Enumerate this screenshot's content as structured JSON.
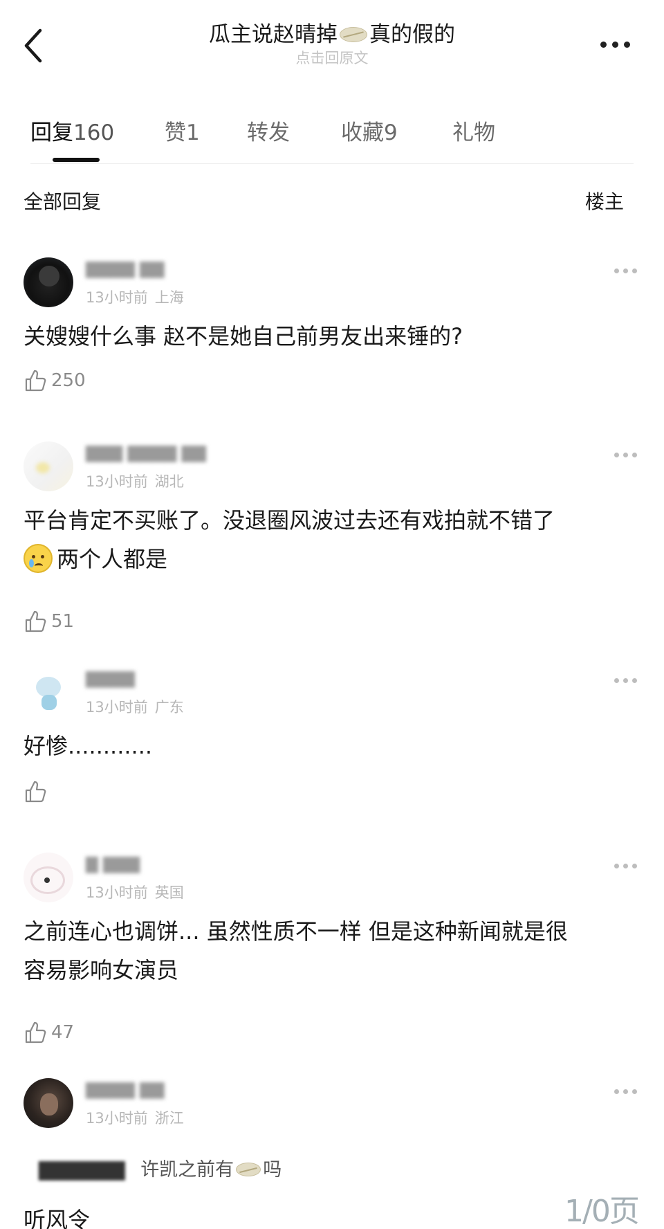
{
  "header": {
    "title_before": "瓜主说赵晴掉",
    "title_after": "真的假的",
    "subtitle": "点击回原文"
  },
  "tabs": [
    {
      "label": "回复",
      "count": "160",
      "active": true
    },
    {
      "label": "赞",
      "count": "1",
      "active": false
    },
    {
      "label": "转发",
      "count": "",
      "active": false
    },
    {
      "label": "收藏",
      "count": "9",
      "active": false
    },
    {
      "label": "礼物",
      "count": "",
      "active": false
    }
  ],
  "filter": {
    "all_label": "全部回复",
    "op_label": "楼主"
  },
  "comments": [
    {
      "time": "13小时前",
      "location": "上海",
      "text": "关嫂嫂什么事 赵不是她自己前男友出来锤的?",
      "likes": "250"
    },
    {
      "time": "13小时前",
      "location": "湖北",
      "text_line1": "平台肯定不买账了。没退圈风波过去还有戏拍就不错了",
      "text_line2": "两个人都是",
      "likes": "51"
    },
    {
      "time": "13小时前",
      "location": "广东",
      "text": "好惨............",
      "likes": ""
    },
    {
      "time": "13小时前",
      "location": "英国",
      "text_line1": "之前连心也调饼... 虽然性质不一样 但是这种新闻就是很",
      "text_line2": "容易影响女演员",
      "likes": "47"
    },
    {
      "time": "13小时前",
      "location": "浙江",
      "quote_text_before": "许凯之前有",
      "quote_text_after": "吗",
      "reply_text": "听风令"
    }
  ],
  "watermark": {
    "number": "1/0页"
  },
  "colors": {
    "text_primary": "#1a1a1a",
    "text_secondary": "#b7b7b7",
    "tab_active_underline": "#111111"
  },
  "icons": [
    "back-arrow-icon",
    "more-horizontal-icon",
    "thumbs-up-icon",
    "crying-face-emoji",
    "blurred-emoji"
  ]
}
